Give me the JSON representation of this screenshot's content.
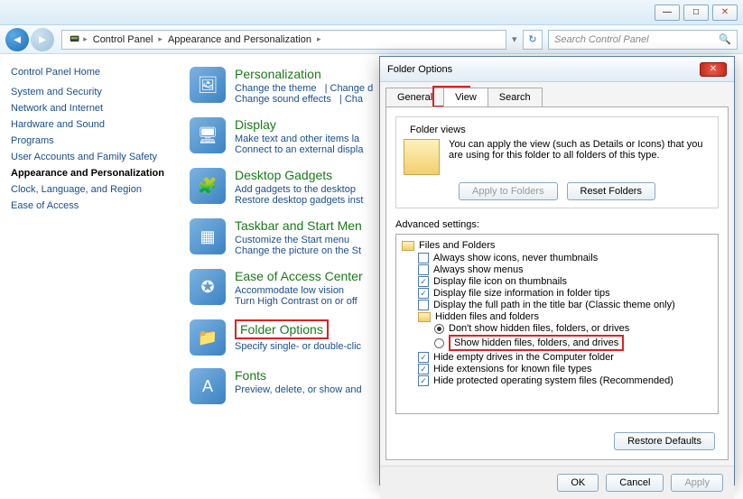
{
  "window": {
    "min": "—",
    "max": "□",
    "close": "✕"
  },
  "nav": {
    "crumb_icon": "▸",
    "crumb1": "Control Panel",
    "crumb2": "Appearance and Personalization",
    "refresh": "↻",
    "search_placeholder": "Search Control Panel"
  },
  "sidebar": {
    "home": "Control Panel Home",
    "items": [
      "System and Security",
      "Network and Internet",
      "Hardware and Sound",
      "Programs",
      "User Accounts and Family Safety",
      "Appearance and Personalization",
      "Clock, Language, and Region",
      "Ease of Access"
    ]
  },
  "cats": [
    {
      "title": "Personalization",
      "subs": [
        "Change the theme",
        "Change d",
        "Change sound effects",
        "Cha"
      ],
      "icon": "🖼"
    },
    {
      "title": "Display",
      "subs": [
        "Make text and other items la",
        "Connect to an external displa"
      ],
      "icon": "🖥"
    },
    {
      "title": "Desktop Gadgets",
      "subs": [
        "Add gadgets to the desktop",
        "Restore desktop gadgets inst"
      ],
      "icon": "🧩"
    },
    {
      "title": "Taskbar and Start Men",
      "subs": [
        "Customize the Start menu",
        "Change the picture on the St"
      ],
      "icon": "▦"
    },
    {
      "title": "Ease of Access Center",
      "subs": [
        "Accommodate low vision",
        "Turn High Contrast on or off"
      ],
      "icon": "✪"
    },
    {
      "title": "Folder Options",
      "subs": [
        "Specify single- or double-clic"
      ],
      "icon": "📁"
    },
    {
      "title": "Fonts",
      "subs": [
        "Preview, delete, or show and"
      ],
      "icon": "A"
    }
  ],
  "dialog": {
    "title": "Folder Options",
    "tabs": {
      "general": "General",
      "view": "View",
      "search": "Search"
    },
    "folder_views_label": "Folder views",
    "folder_views_text": "You can apply the view (such as Details or Icons) that you are using for this folder to all folders of this type.",
    "apply_folders": "Apply to Folders",
    "reset_folders": "Reset Folders",
    "advanced_label": "Advanced settings:",
    "tree": {
      "root": "Files and Folders",
      "items": [
        {
          "text": "Always show icons, never thumbnails",
          "checked": false
        },
        {
          "text": "Always show menus",
          "checked": false
        },
        {
          "text": "Display file icon on thumbnails",
          "checked": true
        },
        {
          "text": "Display file size information in folder tips",
          "checked": true
        },
        {
          "text": "Display the full path in the title bar (Classic theme only)",
          "checked": false
        }
      ],
      "hidden_group": "Hidden files and folders",
      "radios": [
        {
          "text": "Don't show hidden files, folders, or drives",
          "selected": true
        },
        {
          "text": "Show hidden files, folders, and drives",
          "selected": false
        }
      ],
      "items2": [
        {
          "text": "Hide empty drives in the Computer folder",
          "checked": true
        },
        {
          "text": "Hide extensions for known file types",
          "checked": true
        },
        {
          "text": "Hide protected operating system files (Recommended)",
          "checked": true
        }
      ]
    },
    "restore": "Restore Defaults",
    "ok": "OK",
    "cancel": "Cancel",
    "apply": "Apply"
  }
}
